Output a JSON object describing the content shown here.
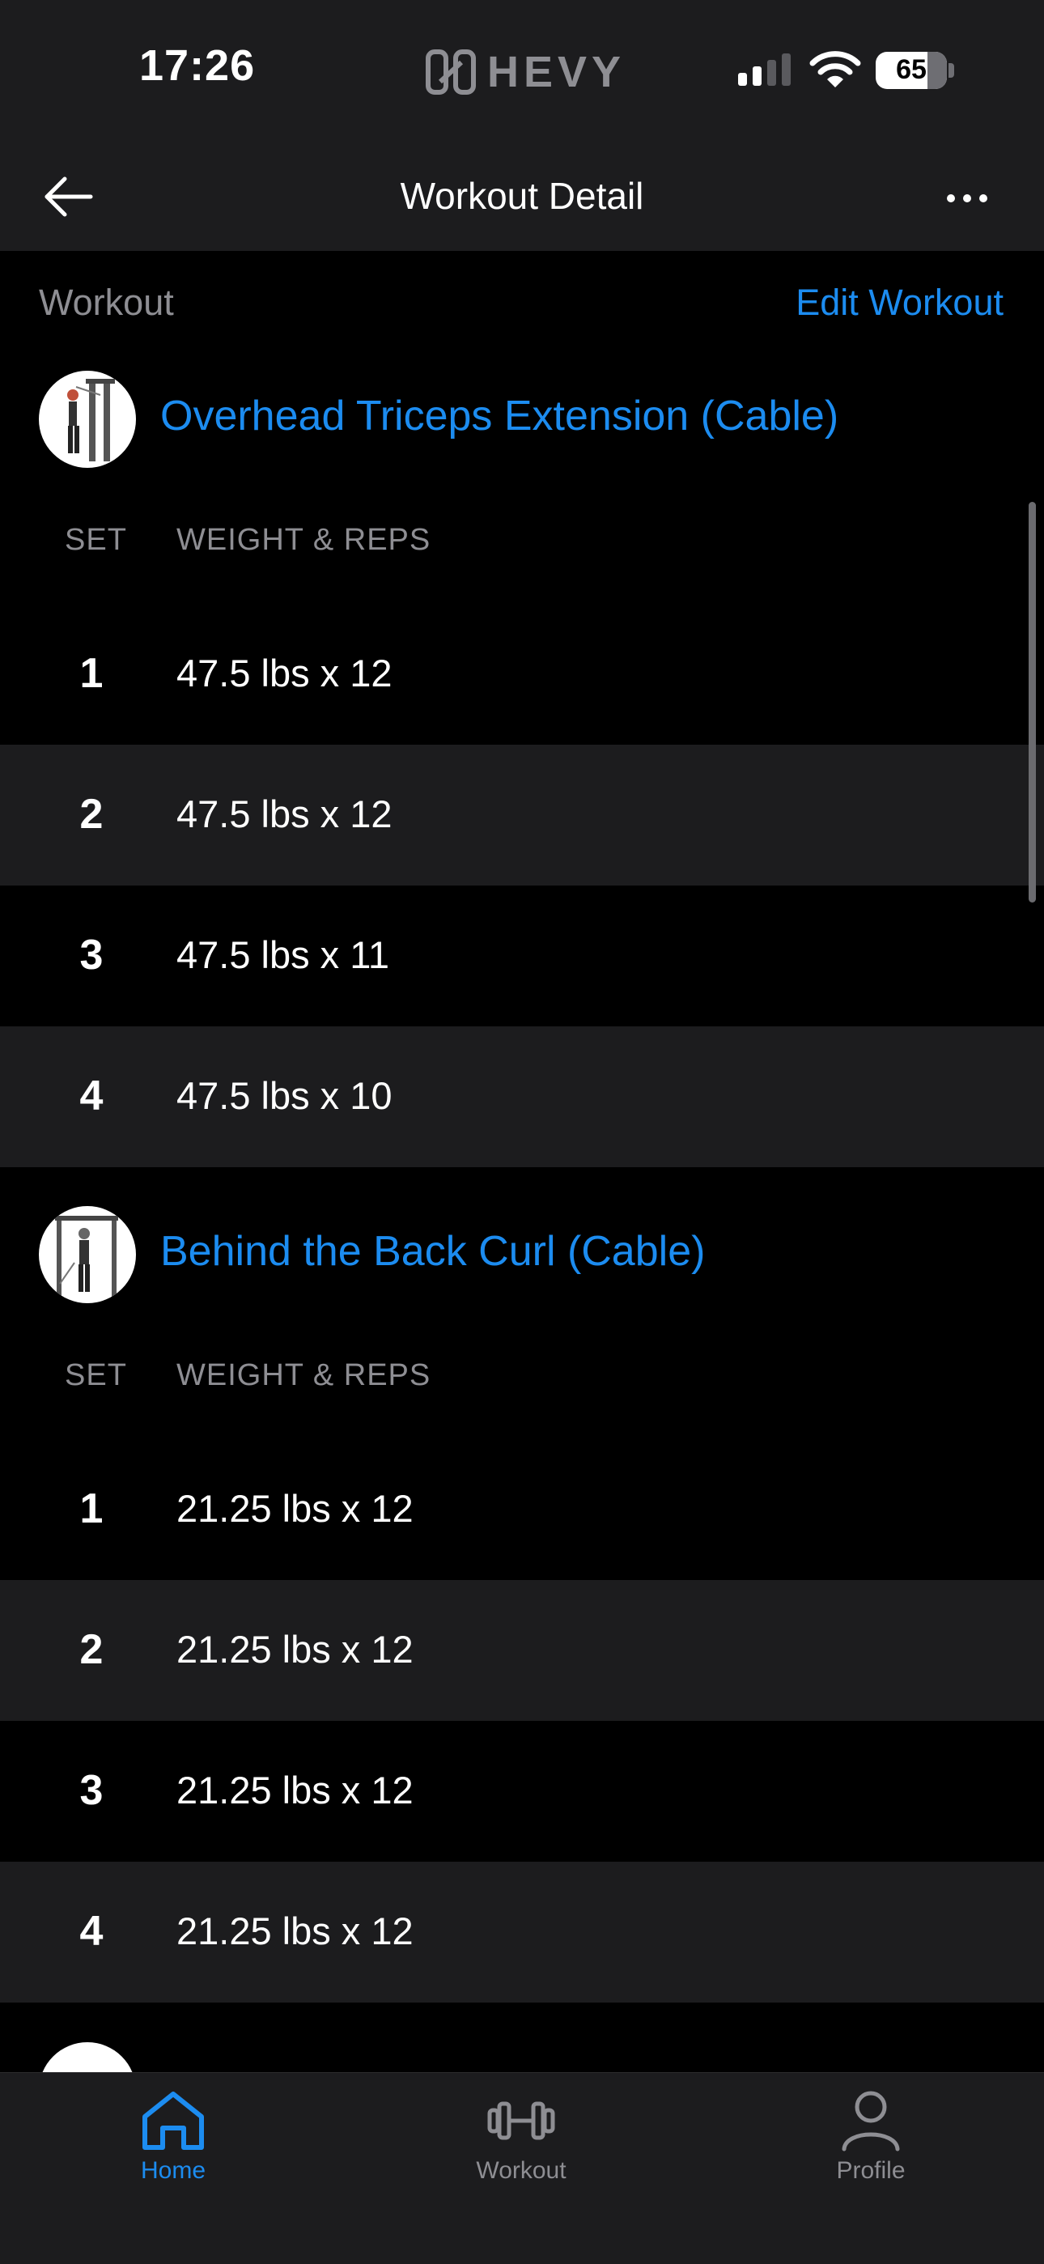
{
  "status_bar": {
    "time": "17:26",
    "carrier_logo": "HEVY",
    "battery": "65",
    "signal_bars_active": 2,
    "signal_bars_total": 4,
    "icons": [
      "hevy-logo-icon",
      "cellular-signal-icon",
      "wifi-icon",
      "battery-icon"
    ]
  },
  "header": {
    "title": "Workout Detail",
    "back_icon": "arrow-left-icon",
    "more_icon": "ellipsis-icon"
  },
  "section": {
    "label": "Workout",
    "edit_label": "Edit Workout"
  },
  "table_headers": {
    "set": "SET",
    "weight_reps": "WEIGHT & REPS"
  },
  "exercises": [
    {
      "name": "Overhead Triceps Extension (Cable)",
      "sets": [
        {
          "num": "1",
          "value": "47.5 lbs x 12"
        },
        {
          "num": "2",
          "value": "47.5 lbs x 12"
        },
        {
          "num": "3",
          "value": "47.5 lbs x 11"
        },
        {
          "num": "4",
          "value": "47.5 lbs x 10"
        }
      ]
    },
    {
      "name": "Behind the Back Curl (Cable)",
      "sets": [
        {
          "num": "1",
          "value": "21.25 lbs x 12"
        },
        {
          "num": "2",
          "value": "21.25 lbs x 12"
        },
        {
          "num": "3",
          "value": "21.25 lbs x 12"
        },
        {
          "num": "4",
          "value": "21.25 lbs x 12"
        }
      ]
    }
  ],
  "tabs": [
    {
      "label": "Home",
      "icon": "home-icon",
      "active": true
    },
    {
      "label": "Workout",
      "icon": "dumbbell-icon",
      "active": false
    },
    {
      "label": "Profile",
      "icon": "profile-icon",
      "active": false
    }
  ],
  "colors": {
    "accent": "#1c8cf0",
    "background": "#000000",
    "surface": "#1c1c1e",
    "muted_text": "#8e8e93"
  }
}
